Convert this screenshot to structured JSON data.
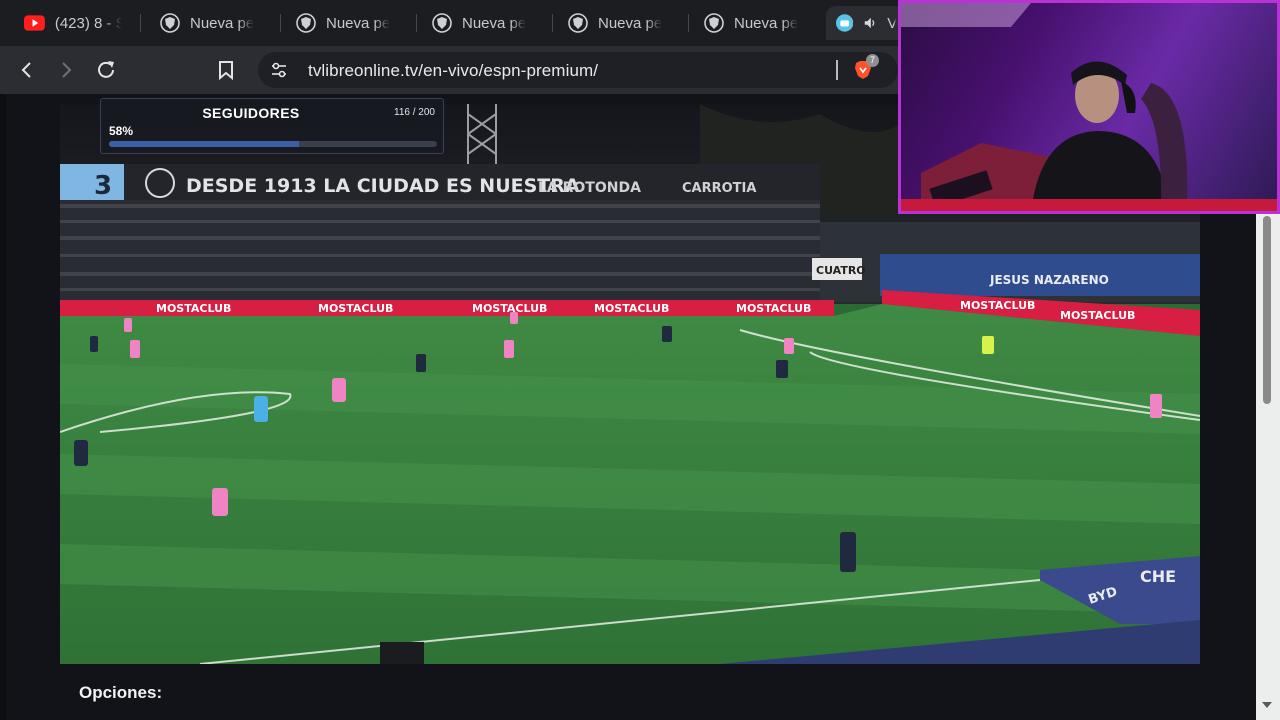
{
  "browser": {
    "tabs": [
      {
        "icon": "youtube-icon",
        "label": "(423) 8 - S",
        "active": false
      },
      {
        "icon": "shield-icon",
        "label": "Nueva pe",
        "active": false
      },
      {
        "icon": "shield-icon",
        "label": "Nueva pe",
        "active": false
      },
      {
        "icon": "shield-icon",
        "label": "Nueva pe",
        "active": false
      },
      {
        "icon": "shield-icon",
        "label": "Nueva pe",
        "active": false
      },
      {
        "icon": "shield-icon",
        "label": "Nueva pe",
        "active": false
      },
      {
        "icon": "site-icon",
        "label": "V",
        "active": true,
        "audio": true
      }
    ],
    "address": {
      "url": "tvlibreonline.tv/en-vivo/espn-premium/"
    },
    "shields_badge": "7"
  },
  "overlay_goal": {
    "title": "SEGUIDORES",
    "count": "116 / 200",
    "percent_label": "58%",
    "progress": 0.58
  },
  "stadium_text": {
    "banner_main": "DESDE 1913 LA CIUDAD ES NUESTRA",
    "banner_right1": "LA ROTONDA",
    "banner_right2": "CARROTIA",
    "banner_number": "3",
    "ad_board": "MOSTACLUB",
    "side_banner": "JESUS NAZARENO",
    "side_box": "CUATRO",
    "bench_sponsor": "BYD",
    "bench_text": "CHE"
  },
  "page": {
    "options_label": "Opciones:"
  },
  "colors": {
    "accent_goal": "#3d5fa8",
    "webcam_border": "#b832d6",
    "adboard": "#d81e42",
    "pitch": "#3a7c3e"
  }
}
